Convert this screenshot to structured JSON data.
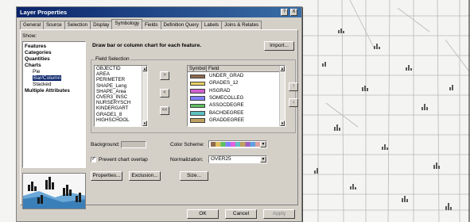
{
  "dialog": {
    "title": "Layer Properties",
    "help_label": "?",
    "close_label": "X"
  },
  "tabs": [
    {
      "label": "General"
    },
    {
      "label": "Source"
    },
    {
      "label": "Selection"
    },
    {
      "label": "Display"
    },
    {
      "label": "Symbology",
      "active": true
    },
    {
      "label": "Fields"
    },
    {
      "label": "Definition Query"
    },
    {
      "label": "Labels"
    },
    {
      "label": "Joins & Relates"
    }
  ],
  "show": {
    "label": "Show:",
    "items": [
      {
        "label": "Features",
        "bold": true
      },
      {
        "label": "Categories",
        "bold": true
      },
      {
        "label": "Quantities",
        "bold": true
      },
      {
        "label": "Charts",
        "bold": true
      },
      {
        "label": "Pie"
      },
      {
        "label": "Bar/Column",
        "selected": true
      },
      {
        "label": "Stacked"
      },
      {
        "label": "Multiple Attributes",
        "bold": true
      }
    ]
  },
  "description": "Draw bar or column chart for each feature.",
  "import_label": "Import...",
  "field_selection": {
    "label": "Field Selection",
    "fields": [
      "OBJECTID",
      "AREA",
      "PERIMETER",
      "SHAPE_Leng",
      "SHAPE_Area",
      "OVER3_INSC",
      "NURSERYSCH",
      "KINDERGART",
      "GRADE1_8",
      "HIGHSCHOOL"
    ],
    "symbol_header": "Symbol",
    "field_header": "Field",
    "selected": [
      {
        "field": "UNDER_GRAD",
        "color": "#8f6a4e"
      },
      {
        "field": "GRADES_12",
        "color": "#e8d060"
      },
      {
        "field": "HSGRAD",
        "color": "#d060d0"
      },
      {
        "field": "SOMECOLLEG",
        "color": "#8080ff"
      },
      {
        "field": "ASSOCDEGRE",
        "color": "#60c060"
      },
      {
        "field": "BACHDEGREE",
        "color": "#60c0c0"
      },
      {
        "field": "GRADDEGREE",
        "color": "#c0a060"
      }
    ],
    "add_label": ">",
    "remove_label": "<",
    "remove_all_label": "<<",
    "up_label": "↑",
    "down_label": "↓"
  },
  "background_label": "Background:",
  "color_scheme_label": "Color Scheme:",
  "prevent_overlap": {
    "label": "Prevent chart overlap",
    "checked": true
  },
  "normalization": {
    "label": "Normalization:",
    "value": "OVER25"
  },
  "buttons": {
    "properties": "Properties...",
    "exclusion": "Exclusion...",
    "size": "Size...",
    "ok": "OK",
    "cancel": "Cancel",
    "apply": "Apply"
  }
}
